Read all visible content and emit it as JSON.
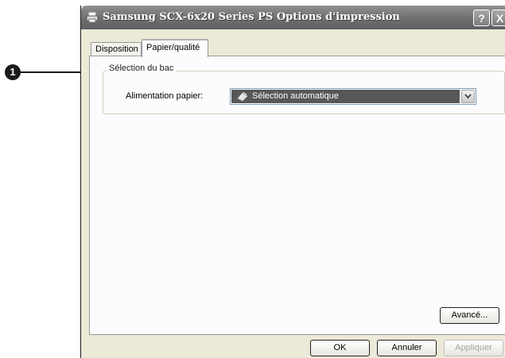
{
  "callout": {
    "number": "1"
  },
  "window": {
    "title": "Samsung SCX-6x20 Series PS Options d'impression",
    "help_label": "?",
    "close_label": "X"
  },
  "tabs": [
    {
      "label": "Disposition",
      "active": false
    },
    {
      "label": "Papier/qualité",
      "active": true
    }
  ],
  "group": {
    "title": "Sélection du bac",
    "alimentation_label": "Alimentation papier:",
    "alimentation_value": "Sélection automatique"
  },
  "buttons": {
    "advanced": "Avancé...",
    "ok": "OK",
    "cancel": "Annuler",
    "apply": "Appliquer"
  },
  "icons": {
    "title": "printer-icon",
    "tray": "paper-tray-icon",
    "dropdown": "chevron-down-icon"
  },
  "colors": {
    "titlebar": "#6f6f6f",
    "dialog_bg": "#ece9d8",
    "selected_value_bg": "#575757"
  }
}
